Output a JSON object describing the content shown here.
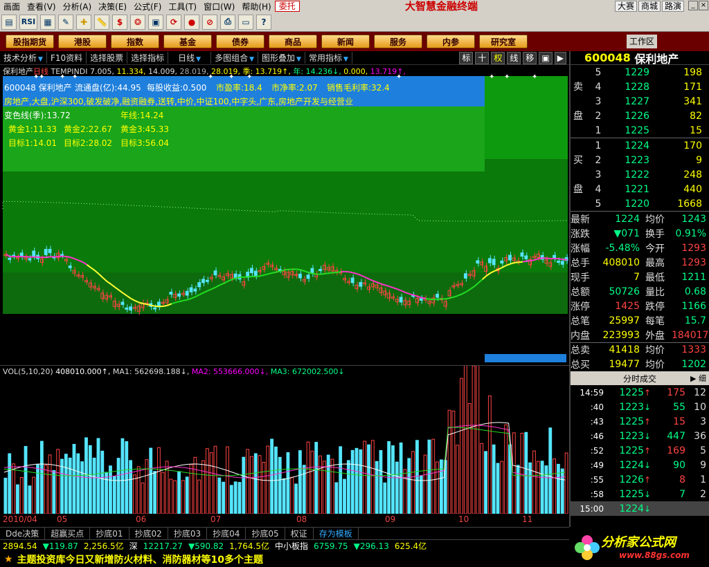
{
  "menubar": {
    "items": [
      "画面",
      "查看(V)",
      "分析(A)",
      "决策(E)",
      "公式(F)",
      "工具(T)",
      "窗口(W)",
      "帮助(H)",
      "委托"
    ],
    "title": "大智慧金融终端",
    "links": [
      "大赛",
      "商城",
      "路演"
    ]
  },
  "toolbar": {
    "rsi": "RSI",
    "dollar": "$",
    "help": "?"
  },
  "nav": {
    "items": [
      "股指期货",
      "港股",
      "指数",
      "基金",
      "债券",
      "商品",
      "新闻",
      "服务",
      "内参",
      "研究室"
    ],
    "workarea": "工作区"
  },
  "ctool": {
    "items": [
      "技术分析",
      "F10资料",
      "选择股票",
      "选择指标",
      "日线",
      "多图组合",
      "图形叠加",
      "常用指标"
    ],
    "right": [
      "标",
      "十",
      "权",
      "线",
      "移"
    ]
  },
  "ind": {
    "name": "保利地产",
    "period": "日线",
    "formula": "TEMPINDI",
    "v1": "7.005,",
    "v2": "11.334,",
    "v3": "14.009,",
    "v4": "28.019,",
    "v5": "28.019,",
    "season": "季: 13.719↑,",
    "year": "年: 14.236↓,",
    "v6": "0.000,",
    "v7": "13.719↑,"
  },
  "info": {
    "line1": [
      "600048 保利地产",
      "流通盘(亿):44.95",
      "每股收益:0.500",
      "市盈率:18.4",
      "市净率:2.07",
      "销售毛利率:32.4"
    ],
    "line2": "房地产,大盘,沪深300,破发破净,融资融券,送转,中价,中证100,中字头,广东,房地产开发与经营业",
    "line3a": "变色线(季):13.72",
    "line3b": "年线:14.24",
    "line4": [
      "黄金1:11.33",
      "黄金2:22.67",
      "黄金3:45.33"
    ],
    "line5": [
      "目标1:14.01",
      "目标2:28.02",
      "目标3:56.04"
    ]
  },
  "vol": {
    "label": "VOL(5,10,20)",
    "v": "408010.000↑,",
    "ma1": "MA1: 562698.188↓,",
    "ma2": "MA2: 553666.000↓,",
    "ma3": "MA3: 672002.500↓"
  },
  "xaxis": [
    "2010/04",
    "05",
    "06",
    "07",
    "08",
    "09",
    "10",
    "11"
  ],
  "btabs": [
    "Dde决策",
    "超赢买点",
    "抄底01",
    "抄底02",
    "抄底03",
    "抄底04",
    "抄底05",
    "权证",
    "存为模板"
  ],
  "idx": {
    "a": "2894.54",
    "b": "▼119.87",
    "c": "2,256.5亿",
    "d": "深",
    "e": "12217.27",
    "f": "▼590.82",
    "g": "1,764.5亿",
    "h": "中小板指",
    "i": "6759.75",
    "j": "▼296.13",
    "k": "625.4亿"
  },
  "news": "主题投资库今日又新增防火材料、消防器材等10多个主题",
  "ad": {
    "big": "分析家公式网",
    "url": "www.88gs.com"
  },
  "rp": {
    "code": "600048",
    "name": "保利地产",
    "sell": [
      [
        "5",
        "1229",
        "198"
      ],
      [
        "4",
        "1228",
        "171"
      ],
      [
        "3",
        "1227",
        "341"
      ],
      [
        "2",
        "1226",
        "82"
      ],
      [
        "1",
        "1225",
        "15"
      ]
    ],
    "buy": [
      [
        "1",
        "1224",
        "170"
      ],
      [
        "2",
        "1223",
        "9"
      ],
      [
        "3",
        "1222",
        "248"
      ],
      [
        "4",
        "1221",
        "440"
      ],
      [
        "5",
        "1220",
        "1668"
      ]
    ],
    "sellside": [
      "卖",
      "盘"
    ],
    "buyside": [
      "买",
      "盘"
    ],
    "quotes": [
      [
        "最新",
        "1224",
        "均价",
        "1243"
      ],
      [
        "涨跌",
        "▼071",
        "换手",
        "0.91%"
      ],
      [
        "涨幅",
        "-5.48%",
        "今开",
        "1293"
      ],
      [
        "总手",
        "408010",
        "最高",
        "1293"
      ],
      [
        "现手",
        "7",
        "最低",
        "1211"
      ],
      [
        "总额",
        "50726",
        "量比",
        "0.68"
      ],
      [
        "涨停",
        "1425",
        "跌停",
        "1166"
      ],
      [
        "总笔",
        "25997",
        "每笔",
        "15.7"
      ],
      [
        "内盘",
        "223993",
        "外盘",
        "184017"
      ],
      [
        "总卖",
        "41418",
        "均价",
        "1333"
      ],
      [
        "总买",
        "19477",
        "均价",
        "1202"
      ]
    ],
    "trhead": "分时成交",
    "trbtn": "细",
    "trades": [
      [
        "14:59",
        "1225",
        "↑",
        "175",
        "12"
      ],
      [
        ":40",
        "1223",
        "↓",
        "55",
        "10"
      ],
      [
        ":43",
        "1225",
        "↑",
        "15",
        "3"
      ],
      [
        ":46",
        "1223",
        "↓",
        "447",
        "36"
      ],
      [
        ":52",
        "1225",
        "↑",
        "169",
        "5"
      ],
      [
        ":49",
        "1224",
        "↓",
        "90",
        "9"
      ],
      [
        ":55",
        "1226",
        "↑",
        "8",
        "1"
      ],
      [
        ":58",
        "1225",
        "↓",
        "7",
        "2"
      ]
    ],
    "lasttime": "15:00",
    "lastprice": "1224"
  },
  "chart_data": {
    "type": "candlestick",
    "colors": {
      "up": "#ff4444",
      "down": "#55e5ff",
      "ma_green": "#22dd22",
      "ma_magenta": "#ff33cc",
      "ma_yellow": "#ffff33"
    },
    "x": [
      "2010/04",
      "05",
      "06",
      "07",
      "08",
      "09",
      "10",
      "11"
    ]
  }
}
